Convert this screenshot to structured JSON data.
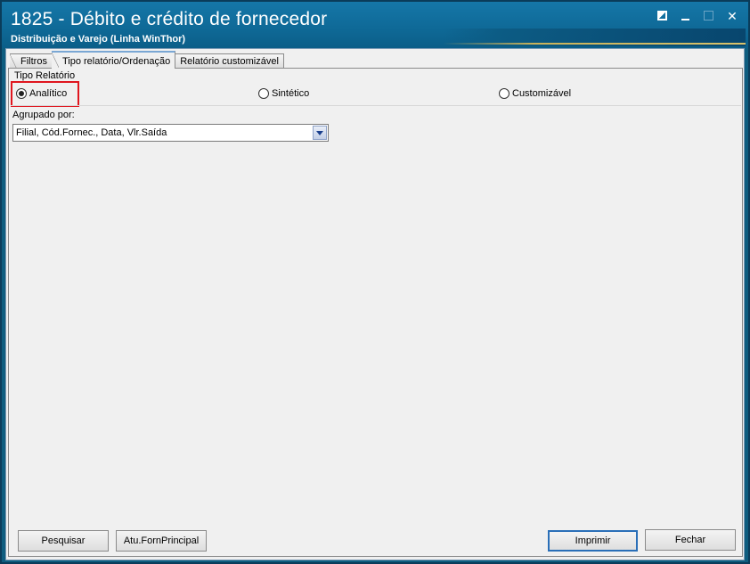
{
  "window": {
    "title": "1825 - Débito e crédito de fornecedor",
    "subtitle": "Distribuição e Varejo (Linha WinThor)",
    "controls": [
      {
        "name": "restore-icon"
      },
      {
        "name": "minimize-icon"
      },
      {
        "name": "maximize-icon"
      },
      {
        "name": "close-icon",
        "glyph": "✕"
      }
    ]
  },
  "tabs": [
    {
      "label": "Filtros",
      "active": false
    },
    {
      "label": "Tipo relatório/Ordenação",
      "active": true
    },
    {
      "label": "Relatório customizável",
      "active": false
    }
  ],
  "tipo_relatorio": {
    "group_label": "Tipo Relatório",
    "options": [
      {
        "label": "Analítico",
        "checked": true,
        "highlighted": true
      },
      {
        "label": "Sintético",
        "checked": false
      },
      {
        "label": "Customizável",
        "checked": false
      }
    ]
  },
  "agrupado": {
    "label": "Agrupado por:",
    "value": "Filial, Cód.Fornec., Data, Vlr.Saída"
  },
  "buttons": {
    "pesquisar": "Pesquisar",
    "atu_forn": "Atu.FornPrincipal",
    "imprimir": "Imprimir",
    "fechar": "Fechar"
  },
  "colors": {
    "title_bar": "#0f6a98",
    "highlight": "#e0161f",
    "default_button_border": "#2a6fb8"
  }
}
